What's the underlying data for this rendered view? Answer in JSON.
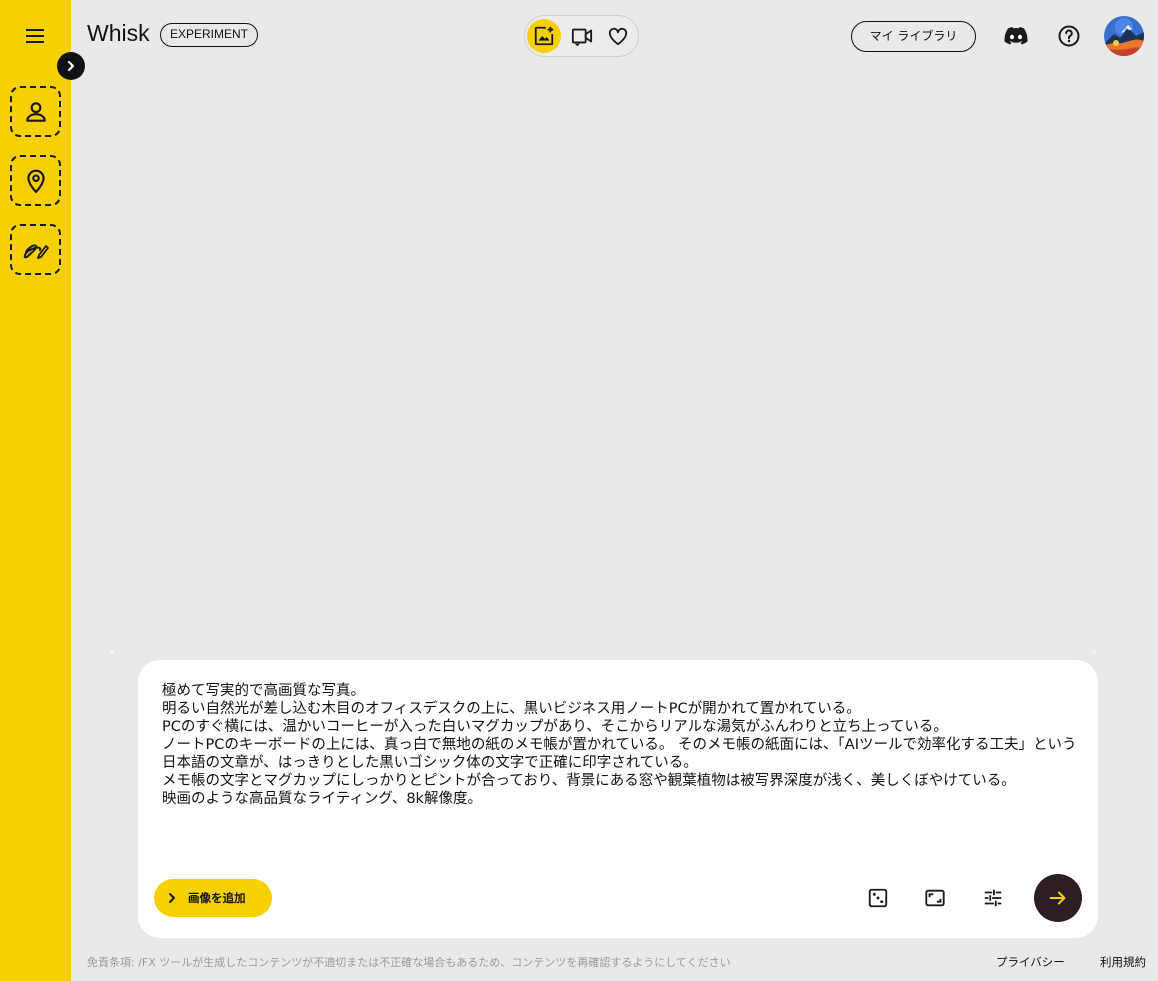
{
  "app": {
    "title": "Whisk",
    "badge": "EXPERIMENT"
  },
  "colors": {
    "accent": "#f8d000",
    "background": "#e9e9e9",
    "send_button": "#2b1f21"
  },
  "sidebar": {
    "menu_icon": "hamburger-menu-icon",
    "expand_icon": "chevron-right-icon",
    "slots": [
      {
        "name": "subject",
        "icon": "person-icon"
      },
      {
        "name": "scene",
        "icon": "location-pin-icon"
      },
      {
        "name": "style",
        "icon": "brush-icon"
      }
    ]
  },
  "header": {
    "modes": [
      {
        "name": "image",
        "icon": "add-photo-icon",
        "active": true
      },
      {
        "name": "video",
        "icon": "video-animate-icon",
        "active": false
      },
      {
        "name": "favorites",
        "icon": "heart-icon",
        "active": false
      }
    ],
    "library_label": "マイ ライブラリ",
    "discord_icon": "discord-icon",
    "help_icon": "help-icon"
  },
  "composer": {
    "prompt": "極めて写実的で高画質な写真。\n明るい自然光が差し込む木目のオフィスデスクの上に、黒いビジネス用ノートPCが開かれて置かれている。\nPCのすぐ横には、温かいコーヒーが入った白いマグカップがあり、そこからリアルな湯気がふんわりと立ち上っている。\nノートPCのキーボードの上には、真っ白で無地の紙のメモ帳が置かれている。 そのメモ帳の紙面には、「AIツールで効率化する工夫」という日本語の文章が、はっきりとした黒いゴシック体の文字で正確に印字されている。\nメモ帳の文字とマグカップにしっかりとピントが合っており、背景にある窓や観葉植物は被写界深度が浅く、美しくぼやけている。\n映画のような高品質なライティング、8k解像度。",
    "add_image_label": "画像を追加",
    "tools": [
      "dice-random-icon",
      "aspect-ratio-icon",
      "settings-tune-icon"
    ],
    "send_icon": "arrow-right-icon"
  },
  "footer": {
    "disclaimer": "免責条項: /FX ツールが生成したコンテンツが不適切または不正確な場合もあるため、コンテンツを再確認するようにしてください",
    "privacy": "プライバシー",
    "terms": "利用規約"
  }
}
